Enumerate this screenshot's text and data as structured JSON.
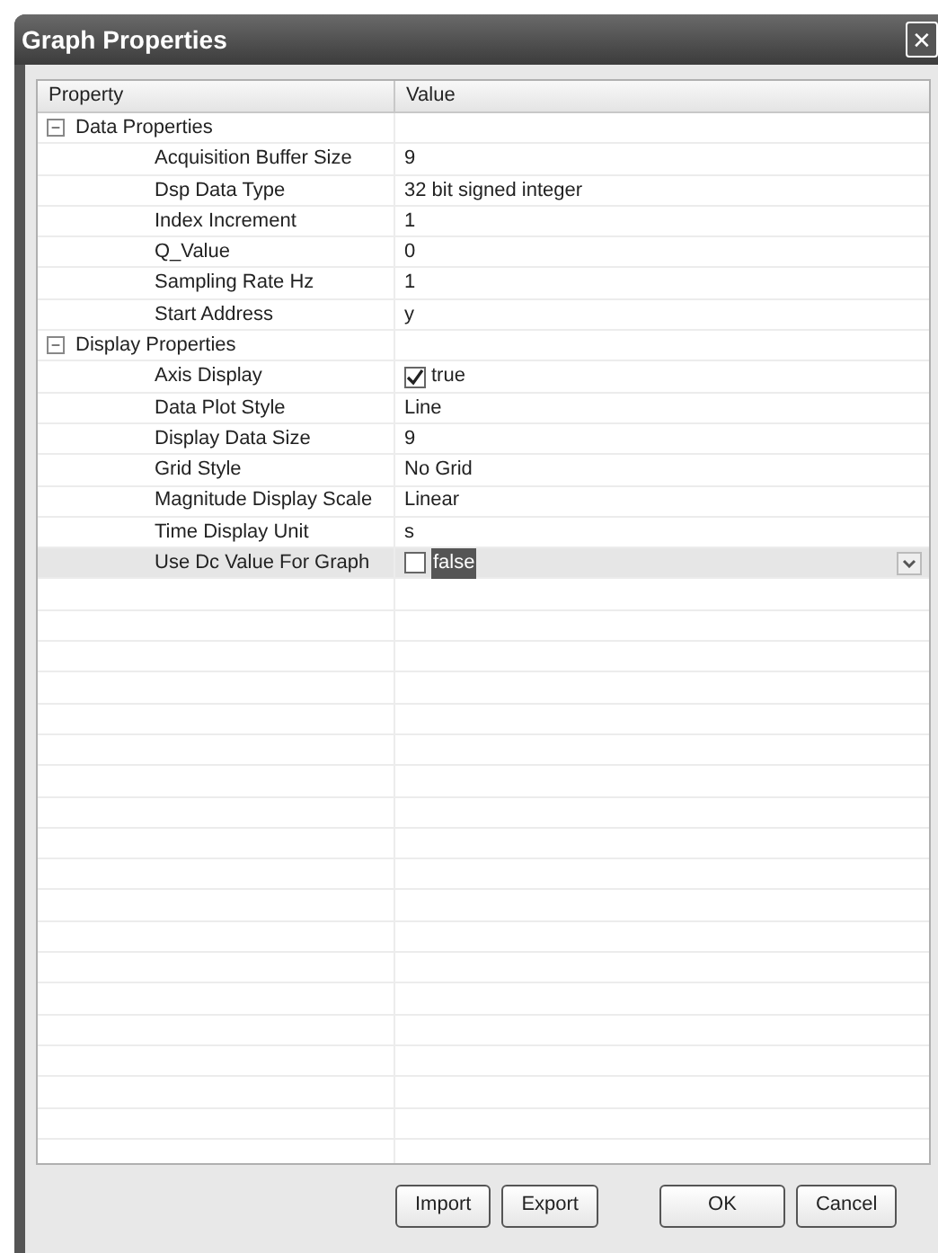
{
  "window": {
    "title": "Graph Properties",
    "close": "✕"
  },
  "grid": {
    "columns": [
      "Property",
      "Value"
    ],
    "groups": [
      {
        "label": "Data Properties",
        "expanded": true,
        "toggle": "−",
        "children": [
          {
            "name": "Acquisition Buffer Size",
            "value": "9",
            "kind": "text",
            "selected": false
          },
          {
            "name": "Dsp Data Type",
            "value": "32 bit signed integer",
            "kind": "text",
            "selected": false
          },
          {
            "name": "Index Increment",
            "value": "1",
            "kind": "text",
            "selected": false
          },
          {
            "name": "Q_Value",
            "value": "0",
            "kind": "text",
            "selected": false
          },
          {
            "name": "Sampling Rate Hz",
            "value": "1",
            "kind": "text",
            "selected": false
          },
          {
            "name": "Start Address",
            "value": "y",
            "kind": "text",
            "selected": false
          }
        ]
      },
      {
        "label": "Display Properties",
        "expanded": true,
        "toggle": "−",
        "children": [
          {
            "name": "Axis Display",
            "value": "true",
            "kind": "checkbox",
            "checked": true,
            "selected": false
          },
          {
            "name": "Data Plot Style",
            "value": "Line",
            "kind": "text",
            "selected": false
          },
          {
            "name": "Display Data Size",
            "value": "9",
            "kind": "text",
            "selected": false
          },
          {
            "name": "Grid Style",
            "value": "No Grid",
            "kind": "text",
            "selected": false
          },
          {
            "name": "Magnitude Display Scale",
            "value": "Linear",
            "kind": "text",
            "selected": false
          },
          {
            "name": "Time Display Unit",
            "value": "s",
            "kind": "text",
            "selected": false
          },
          {
            "name": "Use Dc Value For Graph",
            "value": "false",
            "kind": "checkbox",
            "checked": false,
            "selected": true
          }
        ]
      }
    ]
  },
  "buttons": [
    {
      "label": "Import"
    },
    {
      "label": "Export"
    },
    {
      "label": "OK"
    },
    {
      "label": "Cancel"
    }
  ]
}
